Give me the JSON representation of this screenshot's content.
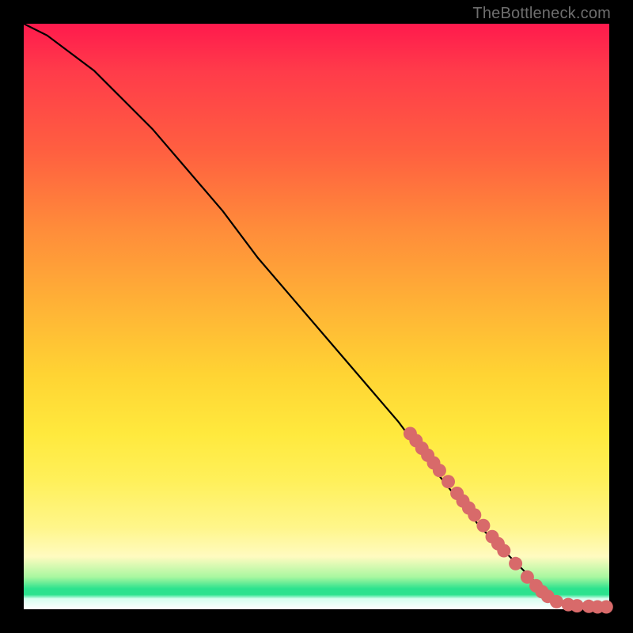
{
  "attribution": "TheBottleneck.com",
  "colors": {
    "frame": "#000000",
    "line": "#000000",
    "marker": "#d86a6a",
    "gradient_stops": [
      "#ff1a4d",
      "#ff3b4a",
      "#ff6040",
      "#ff8c3a",
      "#ffb236",
      "#ffd433",
      "#ffe93d",
      "#fff05a",
      "#fff68a",
      "#fffbc0",
      "#a8f7a0",
      "#2ce28e",
      "#d7fff0",
      "#ffffff"
    ]
  },
  "chart_data": {
    "type": "line",
    "title": "",
    "xlabel": "",
    "ylabel": "",
    "xlim": [
      0,
      100
    ],
    "ylim": [
      0,
      100
    ],
    "grid": false,
    "series": [
      {
        "name": "curve",
        "x": [
          0,
          4,
          8,
          12,
          16,
          22,
          28,
          34,
          40,
          46,
          52,
          58,
          64,
          70,
          74,
          78,
          82,
          86,
          88,
          90,
          92,
          94,
          96,
          98,
          100
        ],
        "y": [
          100,
          98,
          95,
          92,
          88,
          82,
          75,
          68,
          60,
          53,
          46,
          39,
          32,
          24,
          19,
          14,
          10,
          6,
          4,
          2.5,
          1.4,
          0.8,
          0.5,
          0.4,
          0.4
        ]
      }
    ],
    "markers": {
      "name": "highlighted-points",
      "x": [
        66,
        67,
        68,
        69,
        70,
        71,
        72.5,
        74,
        75,
        76,
        77,
        78.5,
        80,
        81,
        82,
        84,
        86,
        87.5,
        88.5,
        89.5,
        91,
        93,
        94.5,
        96.5,
        98,
        99.5
      ],
      "y": [
        30,
        28.8,
        27.5,
        26.3,
        25,
        23.7,
        21.8,
        19.8,
        18.5,
        17.3,
        16.1,
        14.3,
        12.4,
        11.2,
        10,
        7.8,
        5.5,
        4,
        3,
        2.2,
        1.3,
        0.8,
        0.6,
        0.5,
        0.4,
        0.4
      ]
    }
  }
}
